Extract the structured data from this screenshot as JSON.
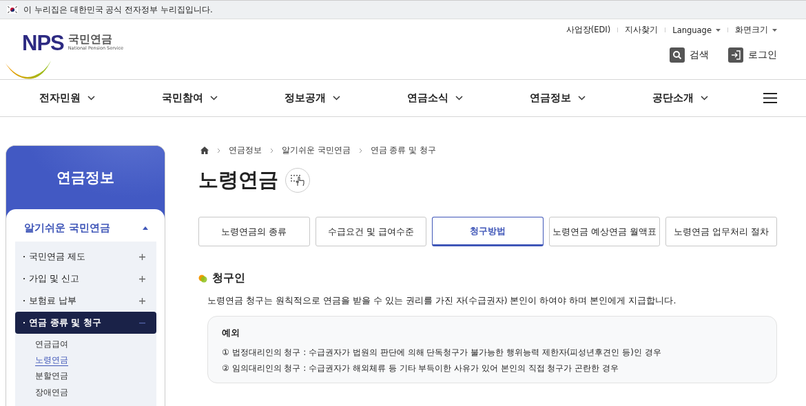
{
  "gov_banner": {
    "text": "이 누리집은 대한민국 공식 전자정부 누리집입니다."
  },
  "logo": {
    "mark": "NPS",
    "name": "국민연금",
    "subtitle": "National Pension Service"
  },
  "utility_links": [
    {
      "label": "사업장(EDI)",
      "kind": "link"
    },
    {
      "label": "지사찾기",
      "kind": "link"
    },
    {
      "label": "Language",
      "kind": "dropdown"
    },
    {
      "label": "화면크기",
      "kind": "dropdown"
    }
  ],
  "header_buttons": [
    {
      "label": "검색",
      "kind": "search"
    },
    {
      "label": "로그인",
      "kind": "login"
    }
  ],
  "main_nav": [
    {
      "label": "전자민원"
    },
    {
      "label": "국민참여"
    },
    {
      "label": "정보공개"
    },
    {
      "label": "연금소식"
    },
    {
      "label": "연금정보"
    },
    {
      "label": "공단소개"
    }
  ],
  "sidebar": {
    "title": "연금정보",
    "section": {
      "label": "알기쉬운 국민연금",
      "expanded": true
    },
    "items": [
      {
        "label": "국민연금 제도",
        "expanded": false,
        "selected": false
      },
      {
        "label": "가입 및 신고",
        "expanded": false,
        "selected": false
      },
      {
        "label": "보험료 납부",
        "expanded": false,
        "selected": false
      },
      {
        "label": "연금 종류 및 청구",
        "expanded": true,
        "selected": true,
        "children": [
          {
            "label": "연금급여",
            "selected": false
          },
          {
            "label": "노령연금",
            "selected": true
          },
          {
            "label": "분할연금",
            "selected": false
          },
          {
            "label": "장애연금",
            "selected": false
          }
        ]
      }
    ]
  },
  "breadcrumb": [
    "연금정보",
    "알기쉬운 국민연금",
    "연금 종류 및 청구"
  ],
  "page_title": "노령연금",
  "tabs": [
    {
      "label": "노령연금의 종류",
      "selected": false
    },
    {
      "label": "수급요건 및 급여수준",
      "selected": false
    },
    {
      "label": "청구방법",
      "selected": true
    },
    {
      "label": "노령연금 예상연금 월액표",
      "selected": false
    },
    {
      "label": "노령연금 업무처리 절차",
      "selected": false
    }
  ],
  "section": {
    "heading": "청구인",
    "text": "노령연금 청구는 원칙적으로 연금을 받을 수 있는 권리를 가진 자(수급권자) 본인이 하여야 하며 본인에게 지급합니다.",
    "note": {
      "title": "예외",
      "items": [
        "① 법정대리인의 청구 : 수급권자가 법원의 판단에 의해 단독청구가 불가능한 행위능력 제한자(피성년후견인 등)인 경우",
        "② 임의대리인의 청구 : 수급권자가 해외체류 등 기타 부득이한 사유가 있어 본인의 직접 청구가 곤란한 경우"
      ]
    }
  }
}
